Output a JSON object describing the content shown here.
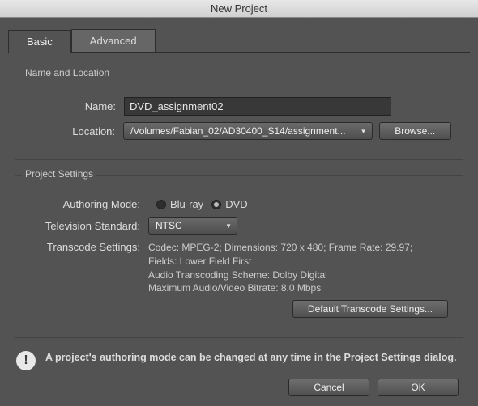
{
  "window": {
    "title": "New Project"
  },
  "tabs": {
    "basic": "Basic",
    "advanced": "Advanced",
    "active": "basic"
  },
  "nameLoc": {
    "group_title": "Name and Location",
    "name_label": "Name:",
    "name_value": "DVD_assignment02",
    "location_label": "Location:",
    "location_value": "/Volumes/Fabian_02/AD30400_S14/assignment...",
    "browse": "Browse..."
  },
  "project": {
    "group_title": "Project Settings",
    "auth_label": "Authoring Mode:",
    "bluray": "Blu-ray",
    "dvd": "DVD",
    "auth_selected": "dvd",
    "tv_label": "Television Standard:",
    "tv_value": "NTSC",
    "trans_label": "Transcode Settings:",
    "trans_line1": "Codec: MPEG-2; Dimensions: 720 x 480; Frame Rate: 29.97;",
    "trans_line2": "Fields: Lower Field First",
    "trans_line3": "Audio Transcoding Scheme: Dolby Digital",
    "trans_line4": "Maximum Audio/Video Bitrate: 8.0 Mbps",
    "default_btn": "Default Transcode Settings..."
  },
  "notice": {
    "icon": "!",
    "text": "A project's authoring mode can be changed at any time in the Project Settings dialog."
  },
  "footer": {
    "cancel": "Cancel",
    "ok": "OK"
  }
}
